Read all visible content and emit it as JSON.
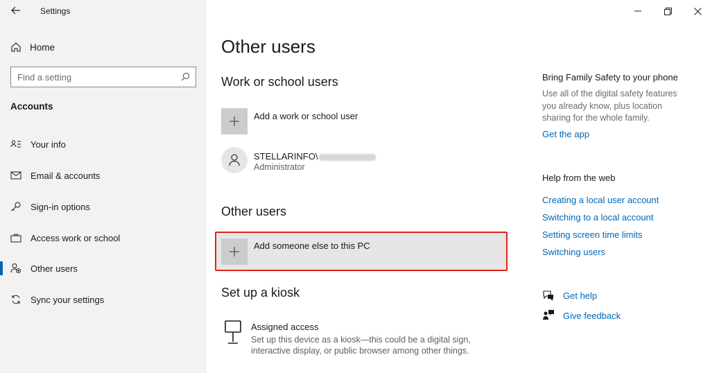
{
  "window": {
    "title": "Settings"
  },
  "sidebar": {
    "home_label": "Home",
    "search_placeholder": "Find a setting",
    "section_heading": "Accounts",
    "items": [
      {
        "label": "Your info",
        "icon": "person-card-icon"
      },
      {
        "label": "Email & accounts",
        "icon": "envelope-icon"
      },
      {
        "label": "Sign-in options",
        "icon": "key-icon"
      },
      {
        "label": "Access work or school",
        "icon": "briefcase-icon"
      },
      {
        "label": "Other users",
        "icon": "add-person-icon",
        "selected": true
      },
      {
        "label": "Sync your settings",
        "icon": "sync-icon"
      }
    ]
  },
  "main": {
    "page_title": "Other users",
    "work_school": {
      "heading": "Work or school users",
      "add_label": "Add a work or school user",
      "account_prefix": "STELLARINFO\\",
      "account_role": "Administrator"
    },
    "other_users": {
      "heading": "Other users",
      "add_label": "Add someone else to this PC"
    },
    "kiosk": {
      "heading": "Set up a kiosk",
      "title": "Assigned access",
      "desc_line1": "Set up this device as a kiosk—this could be a digital sign,",
      "desc_line2": "interactive display, or public browser among other things."
    }
  },
  "right_pane": {
    "family_heading": "Bring Family Safety to your phone",
    "family_desc": "Use all of the digital safety features you already know, plus location sharing for the whole family.",
    "get_app": "Get the app",
    "web_heading": "Help from the web",
    "web_links": [
      "Creating a local user account",
      "Switching to a local account",
      "Setting screen time limits",
      "Switching users"
    ],
    "get_help": "Get help",
    "give_feedback": "Give feedback"
  },
  "colors": {
    "accent": "#0066b4",
    "selection_bar": "#0063b1",
    "highlight_border": "#e2231a",
    "sidebar_bg": "#f2f2f2"
  }
}
